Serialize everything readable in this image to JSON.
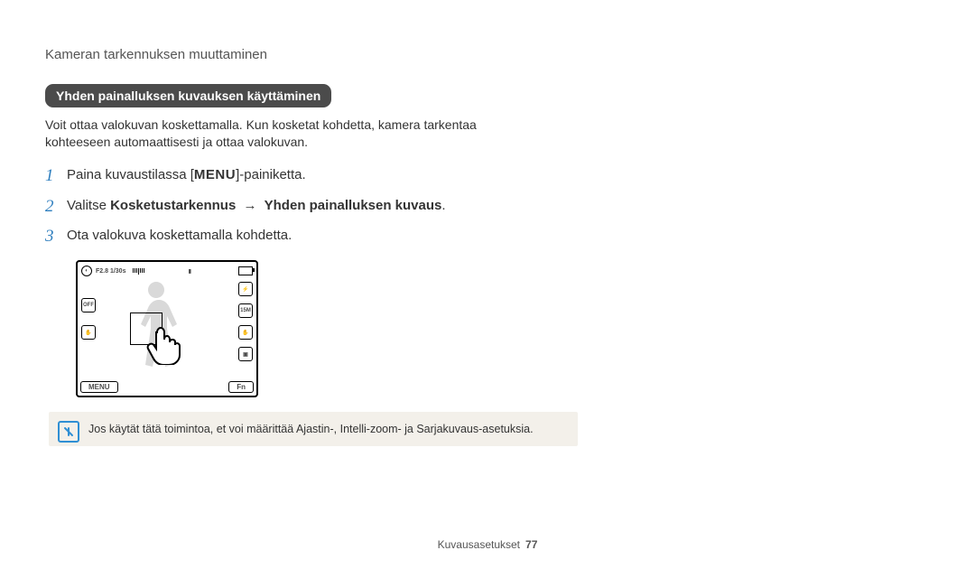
{
  "header": {
    "title": "Kameran tarkennuksen muuttaminen"
  },
  "section": {
    "pill": "Yhden painalluksen kuvauksen käyttäminen",
    "intro": "Voit ottaa valokuvan koskettamalla. Kun kosketat kohdetta, kamera tarkentaa kohteeseen automaattisesti ja ottaa valokuvan."
  },
  "steps": {
    "s1_num": "1",
    "s1_pre": "Paina kuvaustilassa [",
    "s1_label": "MENU",
    "s1_post": "]-painiketta.",
    "s2_num": "2",
    "s2_pre": "Valitse ",
    "s2_b1": "Kosketustarkennus",
    "s2_arrow": "→",
    "s2_b2": "Yhden painalluksen kuvaus",
    "s2_post": ".",
    "s3_num": "3",
    "s3_text": "Ota valokuva koskettamalla kohdetta."
  },
  "lcd": {
    "exposure": "F2.8 1/30s",
    "menu": "MENU",
    "fn": "Fn",
    "left1": "OFF",
    "right_flash": "⚡",
    "right_size": "15M"
  },
  "note": {
    "text": "Jos käytät tätä toimintoa, et voi määrittää Ajastin-, Intelli-zoom- ja Sarjakuvaus-asetuksia."
  },
  "footer": {
    "section": "Kuvausasetukset",
    "page": "77"
  }
}
